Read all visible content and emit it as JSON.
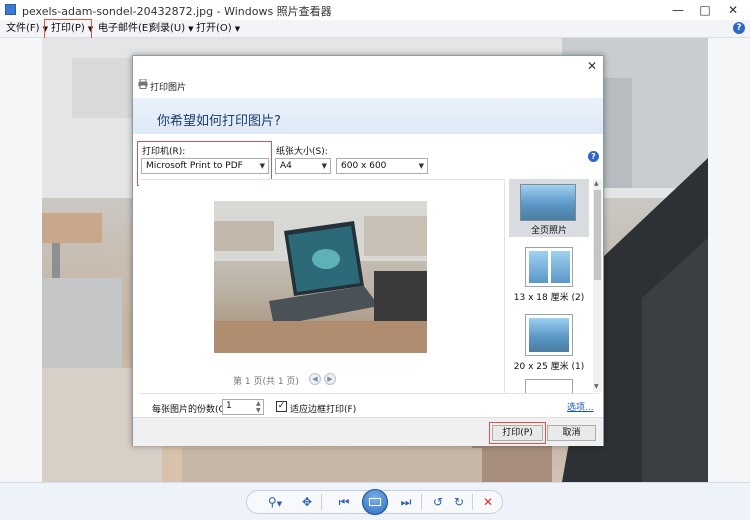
{
  "window": {
    "title": "pexels-adam-sondel-20432872.jpg - Windows 照片查看器",
    "minimize_icon": "minimize-icon",
    "maximize_icon": "maximize-icon",
    "close_icon": "close-icon"
  },
  "menubar": {
    "items": [
      {
        "label": "文件(F)"
      },
      {
        "label": "打印(P)"
      },
      {
        "label": "电子邮件(E)"
      },
      {
        "label": "刻录(U)"
      },
      {
        "label": "打开(O)"
      }
    ],
    "help": "?"
  },
  "dialog": {
    "title": "打印图片",
    "question": "你希望如何打印图片?",
    "printer_label": "打印机(R):",
    "printer_value": "Microsoft Print to PDF",
    "paper_label": "纸张大小(S):",
    "paper_value": "A4",
    "quality_value": "600 x 600",
    "help": "?",
    "pager": "第 1 页(共 1 页)",
    "layouts": [
      {
        "label": "全页照片"
      },
      {
        "label": "13 x 18 厘米 (2)"
      },
      {
        "label": "20 x 25 厘米 (1)"
      }
    ],
    "copies_label": "每张图片的份数(C):",
    "copies_value": "1",
    "fit_label": "适应边框打印(F)",
    "fit_checked": true,
    "options_link": "选项...",
    "print_button": "打印(P)",
    "cancel_button": "取消"
  },
  "colors": {
    "highlight": "#e0524a",
    "accent": "#2f66c8"
  }
}
